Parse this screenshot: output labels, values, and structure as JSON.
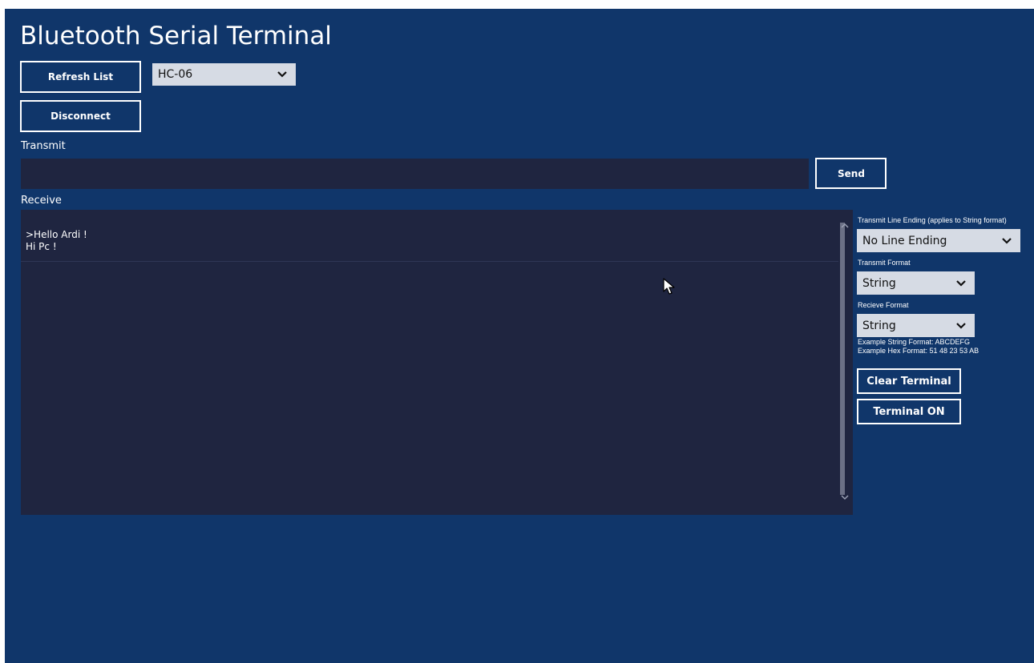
{
  "app": {
    "title": "Bluetooth Serial Terminal"
  },
  "connection": {
    "refresh_label": "Refresh List",
    "disconnect_label": "Disconnect",
    "device_selected": "HC-06"
  },
  "transmit": {
    "section_label": "Transmit",
    "input_value": "",
    "send_label": "Send"
  },
  "receive": {
    "section_label": "Receive",
    "lines": ">Hello Ardi !\nHi Pc !"
  },
  "settings": {
    "line_ending_label": "Transmit Line Ending (applies to String format)",
    "line_ending_selected": "No Line Ending",
    "transmit_format_label": "Transmit Format",
    "transmit_format_selected": "String",
    "receive_format_label": "Recieve Format",
    "receive_format_selected": "String",
    "example_string": "Example String Format: ABCDEFG",
    "example_hex": "Example Hex Format: 51 48 23 53 AB",
    "clear_label": "Clear Terminal",
    "terminal_toggle_label": "Terminal ON"
  },
  "icons": {
    "dropdown": "chevron-down-icon",
    "scroll_up": "scroll-up-arrow-icon",
    "scroll_down": "scroll-down-arrow-icon",
    "cursor": "mouse-pointer-icon"
  },
  "colors": {
    "background": "#10366a",
    "panel": "#1f2540",
    "dropdown": "#d6dbe4",
    "text": "#ffffff"
  }
}
